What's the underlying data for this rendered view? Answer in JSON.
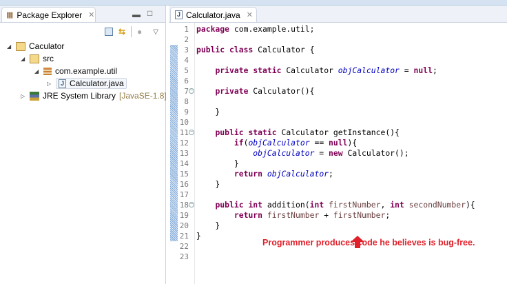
{
  "explorer": {
    "tab_label": "Package Explorer",
    "tree": [
      {
        "label": "Caculator",
        "icon": "project-folder-icon",
        "depth": 0,
        "expanded": true
      },
      {
        "label": "src",
        "icon": "source-folder-icon",
        "depth": 1,
        "expanded": true
      },
      {
        "label": "com.example.util",
        "icon": "package-icon",
        "depth": 2,
        "expanded": true
      },
      {
        "label": "Calculator.java",
        "icon": "java-file-icon",
        "depth": 3,
        "expanded": false,
        "selected": true
      },
      {
        "label": "JRE System Library",
        "decoration": "[JavaSE-1.8]",
        "icon": "library-icon",
        "depth": 1,
        "expanded": false
      }
    ]
  },
  "editor": {
    "tab_label": "Calculator.java",
    "lines": [
      [
        [
          "k",
          "package"
        ],
        [
          "t",
          " com.example.util;"
        ]
      ],
      [],
      [
        [
          "k",
          "public"
        ],
        [
          "t",
          " "
        ],
        [
          "k",
          "class"
        ],
        [
          "t",
          " Calculator {"
        ]
      ],
      [],
      [
        [
          "t",
          "    "
        ],
        [
          "k",
          "private"
        ],
        [
          "t",
          " "
        ],
        [
          "k",
          "static"
        ],
        [
          "t",
          " Calculator "
        ],
        [
          "f",
          "objCalculator"
        ],
        [
          "t",
          " = "
        ],
        [
          "k",
          "null"
        ],
        [
          "t",
          ";"
        ]
      ],
      [],
      [
        [
          "t",
          "    "
        ],
        [
          "k",
          "private"
        ],
        [
          "t",
          " Calculator(){"
        ]
      ],
      [],
      [
        [
          "t",
          "    }"
        ]
      ],
      [],
      [
        [
          "t",
          "    "
        ],
        [
          "k",
          "public"
        ],
        [
          "t",
          " "
        ],
        [
          "k",
          "static"
        ],
        [
          "t",
          " Calculator getInstance(){"
        ]
      ],
      [
        [
          "t",
          "        "
        ],
        [
          "k",
          "if"
        ],
        [
          "t",
          "("
        ],
        [
          "f",
          "objCalculator"
        ],
        [
          "t",
          " == "
        ],
        [
          "k",
          "null"
        ],
        [
          "t",
          "){"
        ]
      ],
      [
        [
          "t",
          "            "
        ],
        [
          "f",
          "objCalculator"
        ],
        [
          "t",
          " = "
        ],
        [
          "k",
          "new"
        ],
        [
          "t",
          " Calculator();"
        ]
      ],
      [
        [
          "t",
          "        }"
        ]
      ],
      [
        [
          "t",
          "        "
        ],
        [
          "k",
          "return"
        ],
        [
          "t",
          " "
        ],
        [
          "f",
          "objCalculator"
        ],
        [
          "t",
          ";"
        ]
      ],
      [
        [
          "t",
          "    }"
        ]
      ],
      [],
      [
        [
          "t",
          "    "
        ],
        [
          "k",
          "public"
        ],
        [
          "t",
          " "
        ],
        [
          "k",
          "int"
        ],
        [
          "t",
          " addition("
        ],
        [
          "k",
          "int"
        ],
        [
          "t",
          " "
        ],
        [
          "v",
          "firstNumber"
        ],
        [
          "t",
          ", "
        ],
        [
          "k",
          "int"
        ],
        [
          "t",
          " "
        ],
        [
          "v",
          "secondNumber"
        ],
        [
          "t",
          "){"
        ]
      ],
      [
        [
          "t",
          "        "
        ],
        [
          "k",
          "return"
        ],
        [
          "t",
          " "
        ],
        [
          "v",
          "firstNumber"
        ],
        [
          "t",
          " + "
        ],
        [
          "v",
          "firstNumber"
        ],
        [
          "t",
          ";"
        ]
      ],
      [
        [
          "t",
          "    }"
        ]
      ],
      [
        [
          "t",
          "}"
        ]
      ],
      [],
      []
    ],
    "fold_lines": [
      7,
      11,
      18
    ]
  },
  "annotation": {
    "text": "Programmer produces code he believes is bug-free.",
    "color": "#e0202a"
  }
}
